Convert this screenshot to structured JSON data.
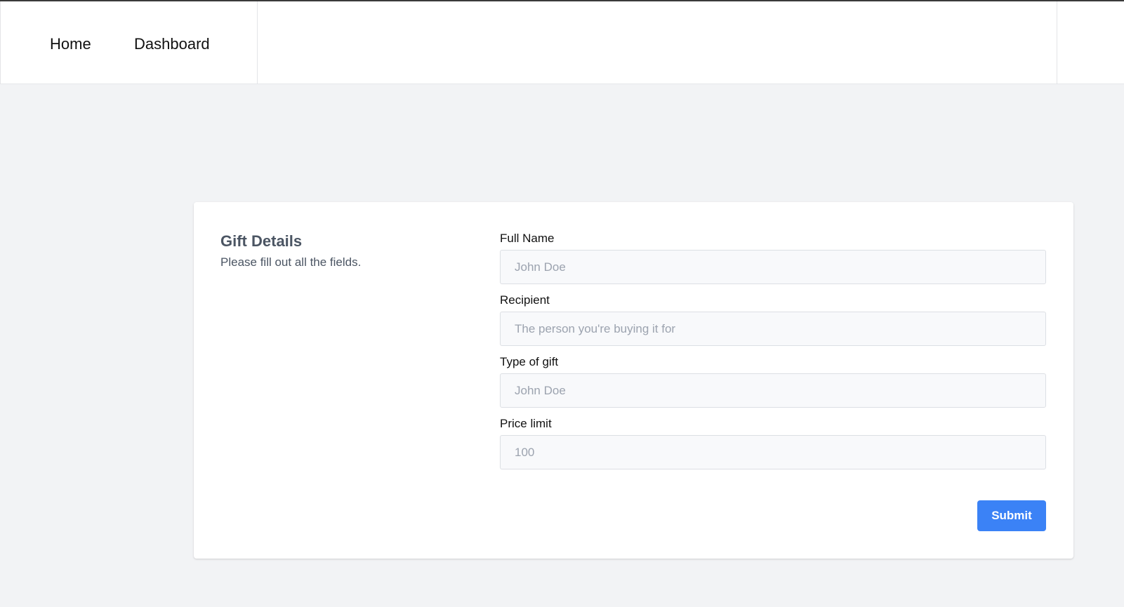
{
  "nav": {
    "home_label": "Home",
    "dashboard_label": "Dashboard"
  },
  "form": {
    "title": "Gift Details",
    "description": "Please fill out all the fields.",
    "fields": [
      {
        "label": "Full Name",
        "placeholder": "John Doe"
      },
      {
        "label": "Recipient",
        "placeholder": "The person you're buying it for"
      },
      {
        "label": "Type of gift",
        "placeholder": "John Doe"
      },
      {
        "label": "Price limit",
        "placeholder": "100"
      }
    ],
    "submit_label": "Submit"
  },
  "colors": {
    "background": "#f2f3f5",
    "accent": "#3b82f6",
    "input_background": "#f8f9fb"
  }
}
